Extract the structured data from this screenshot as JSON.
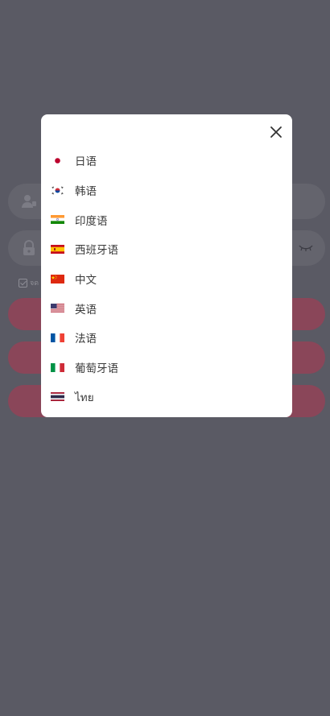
{
  "modal": {
    "close_icon": "close-icon",
    "languages": [
      {
        "label": "日语",
        "flag": "japan-flag-icon"
      },
      {
        "label": "韩语",
        "flag": "korea-flag-icon"
      },
      {
        "label": "印度语",
        "flag": "india-flag-icon"
      },
      {
        "label": "西班牙语",
        "flag": "spain-flag-icon"
      },
      {
        "label": "中文",
        "flag": "china-flag-icon"
      },
      {
        "label": "英语",
        "flag": "usa-flag-icon"
      },
      {
        "label": "法语",
        "flag": "france-flag-icon"
      },
      {
        "label": "葡萄牙语",
        "flag": "italy-flag-icon"
      },
      {
        "label": "ไทย",
        "flag": "thailand-flag-icon"
      }
    ]
  },
  "background": {
    "remember_label": "จด",
    "overlay_color": "#5a5a64",
    "button_color": "#8a4659"
  }
}
